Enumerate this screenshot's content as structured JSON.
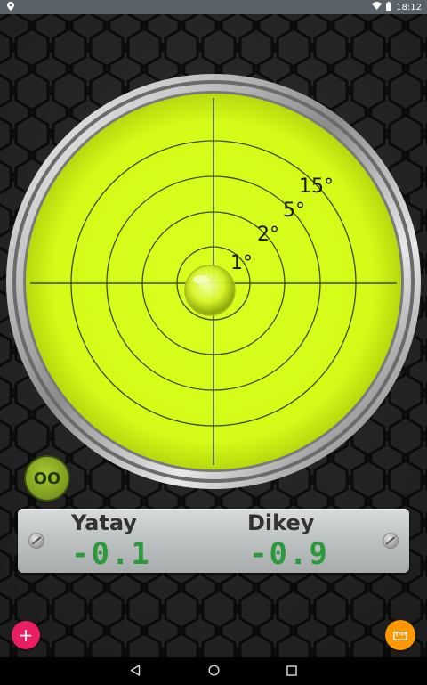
{
  "status_bar": {
    "time": "18:12"
  },
  "level": {
    "ring_labels": [
      "1°",
      "2°",
      "5°",
      "15°"
    ]
  },
  "calibrate_button": {
    "label": "OO"
  },
  "readout": {
    "horizontal_label": "Yatay",
    "horizontal_value": "-0.1",
    "vertical_label": "Dikey",
    "vertical_value": "-0.9"
  },
  "colors": {
    "bubble_fluid": "#d7ff1a",
    "readout_digits": "#2a9a3a",
    "add_fab": "#e91e63",
    "ruler_fab": "#ff9800"
  },
  "icons": {
    "add": "plus-icon",
    "ruler": "ruler-icon",
    "back": "back-icon",
    "home": "home-icon",
    "recents": "recents-icon"
  }
}
